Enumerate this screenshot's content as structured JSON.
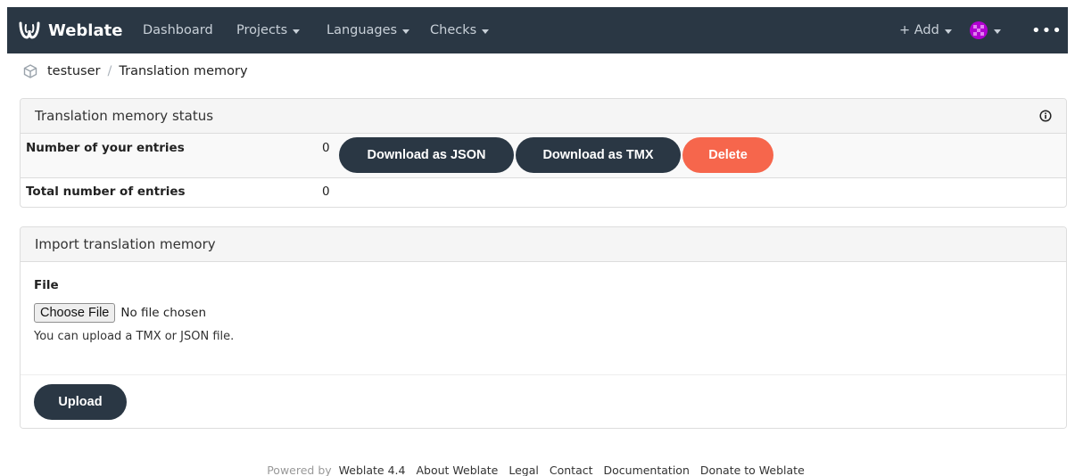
{
  "navbar": {
    "brand": "Weblate",
    "items": [
      {
        "label": "Dashboard",
        "dropdown": false
      },
      {
        "label": "Projects",
        "dropdown": true
      },
      {
        "label": "Languages",
        "dropdown": true
      },
      {
        "label": "Checks",
        "dropdown": true
      }
    ],
    "add_label": "+ Add",
    "more_label": "•••",
    "colors": {
      "background": "#2a3744",
      "avatar": "#b000d0"
    }
  },
  "breadcrumb": {
    "icon": "user-cube-icon",
    "items": [
      "testuser",
      "Translation memory"
    ],
    "separator": "/"
  },
  "status_panel": {
    "title": "Translation memory status",
    "icon": "info-icon",
    "rows": [
      {
        "label": "Number of your entries",
        "value": "0"
      },
      {
        "label": "Total number of entries",
        "value": "0"
      }
    ],
    "buttons": {
      "json": "Download as JSON",
      "tmx": "Download as TMX",
      "delete": "Delete"
    }
  },
  "import_panel": {
    "title": "Import translation memory",
    "file_label": "File",
    "choose_button": "Choose File",
    "file_status": "No file chosen",
    "help_text": "You can upload a TMX or JSON file.",
    "upload_button": "Upload"
  },
  "footer": {
    "powered_by": "Powered by",
    "links": [
      "Weblate 4.4",
      "About Weblate",
      "Legal",
      "Contact",
      "Documentation",
      "Donate to Weblate"
    ]
  },
  "colors": {
    "primary": "#2a3744",
    "danger": "#f6664c",
    "panel_heading": "#f5f5f5"
  }
}
